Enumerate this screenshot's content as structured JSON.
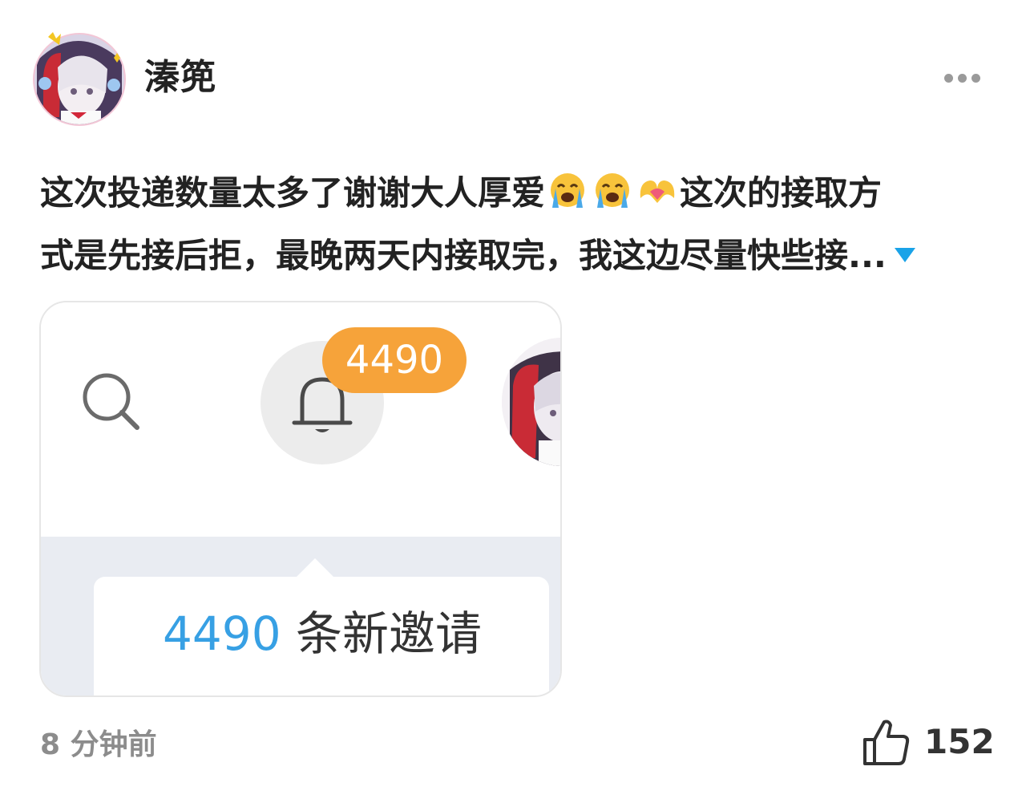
{
  "user": {
    "name": "溱篼",
    "avatar_icon": "anime-avatar"
  },
  "post": {
    "text_line1_a": "这次投递数量太多了谢谢大人厚爱",
    "emoji_1": "loudly-crying-face",
    "emoji_2": "loudly-crying-face",
    "emoji_3": "heart-hands",
    "text_line1_b": "这次的接取方",
    "text_line2": "式是先接后拒，最晚两天内接取完，我这边尽量快些接...",
    "expand_icon": "triangle-down-icon"
  },
  "screenshot_card": {
    "badge_count": "4490",
    "tooltip_count": "4490",
    "tooltip_text": " 条新邀请",
    "badge_color": "#f6a33a",
    "count_color": "#37a0e4"
  },
  "footer": {
    "time": "8 分钟前",
    "like_count": "152",
    "like_icon": "thumbs-up-icon"
  },
  "colors": {
    "accent": "#1aa3e8",
    "muted": "#8c8c8c"
  }
}
